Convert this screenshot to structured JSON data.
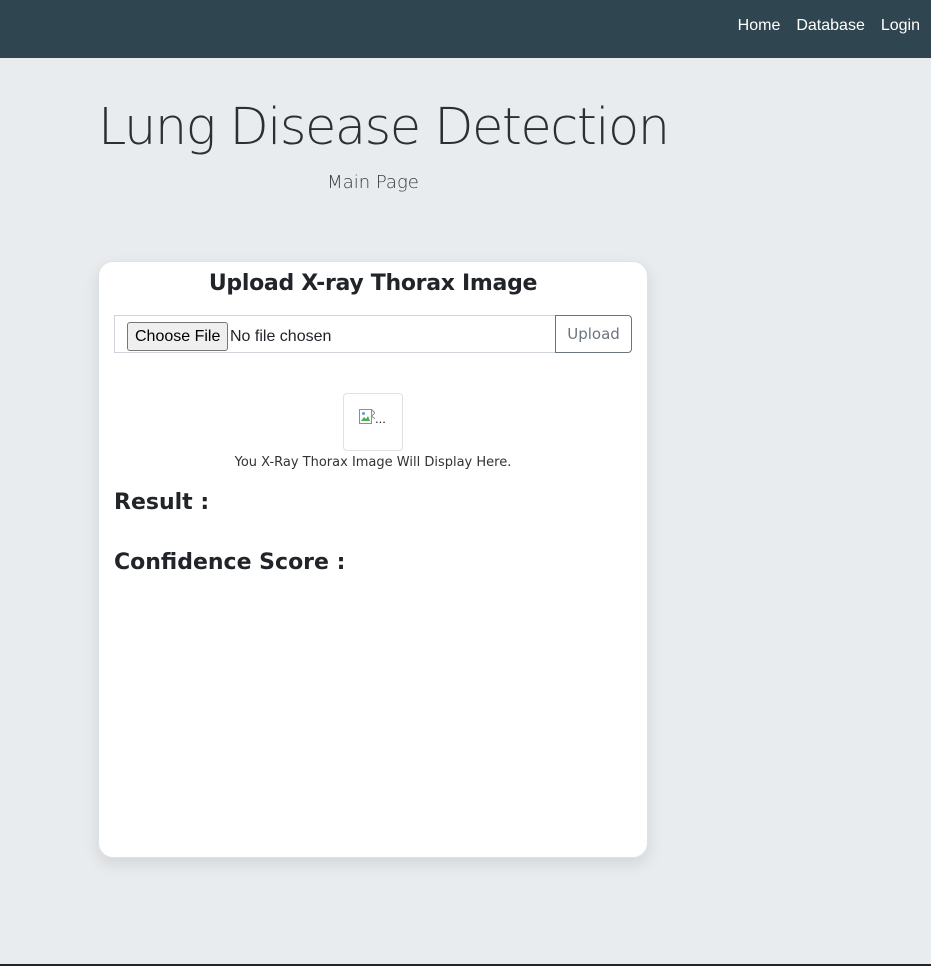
{
  "nav": {
    "links": [
      {
        "label": "Home"
      },
      {
        "label": "Database"
      },
      {
        "label": "Login"
      }
    ]
  },
  "hero": {
    "title": "Lung Disease Detection",
    "subtitle": "Main Page"
  },
  "upload_card": {
    "title": "Upload X-ray Thorax Image",
    "file_input": {
      "button_label": "Choose File",
      "status": "No file chosen"
    },
    "upload_label": "Upload",
    "preview": {
      "alt_text": "...",
      "caption": "You X-Ray Thorax Image Will Display Here."
    },
    "result_label": "Result :",
    "confidence_label": "Confidence Score :"
  },
  "colors": {
    "navbar": "#2f4550",
    "background": "#e9ecef",
    "card": "#ffffff",
    "button_outline": "#6c757d"
  }
}
